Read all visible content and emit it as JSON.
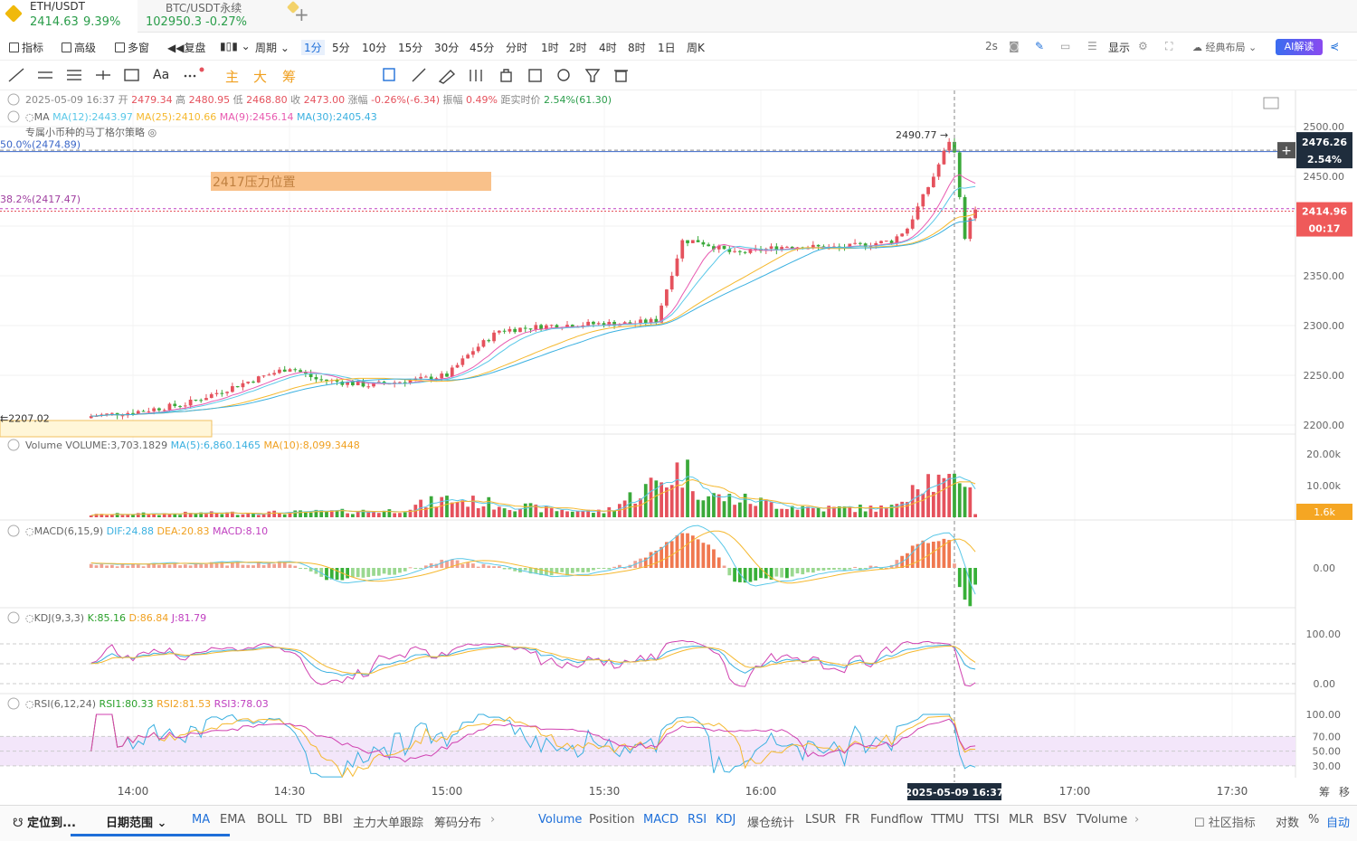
{
  "tabs": [
    {
      "symbol": "ETH/USDT",
      "price": "2414.63",
      "change": "9.39%"
    },
    {
      "symbol": "BTC/USDT永续",
      "price": "102950.3",
      "change": "-0.27%"
    }
  ],
  "tab_add": "+",
  "toolbar": {
    "indicator": "指标",
    "advanced": "高级",
    "multi_window": "多窗",
    "replay": "复盘",
    "period": "周期",
    "timeframes": [
      "1分",
      "5分",
      "10分",
      "15分",
      "30分",
      "45分",
      "分时",
      "1时",
      "2时",
      "4时",
      "8时",
      "1日",
      "周K"
    ],
    "active_timeframe": "1分",
    "refresh": "2s",
    "display": "显示",
    "layout": "经典布局",
    "ai": "AI解读"
  },
  "draw_tools": {
    "text": "Aa",
    "main": "主",
    "big": "大",
    "chip": "筹"
  },
  "info": {
    "date": "2025-05-09 16:37",
    "open_label": "开",
    "open": "2479.34",
    "high_label": "高",
    "high": "2480.95",
    "low_label": "低",
    "low": "2468.80",
    "close_label": "收",
    "close": "2473.00",
    "chg_label": "涨幅",
    "chg": "-0.26%(-6.34)",
    "amp_label": "振幅",
    "amp": "0.49%",
    "dist_label": "距实时价",
    "dist": "2.54%(61.30)"
  },
  "ma_legend": {
    "label": "MA",
    "ma12": "MA(12):2443.97",
    "ma25": "MA(25):2410.66",
    "ma9": "MA(9):2456.14",
    "ma30": "MA(30):2405.43"
  },
  "strategy": "专属小币种的马丁格尔策略",
  "annotations": {
    "fib50": "50.0%(2474.89)",
    "fib38": "38.2%(2417.47)",
    "pressure": "2417压力位置",
    "high_marker": "2490.77",
    "low_marker": "2207.02"
  },
  "price_axis": {
    "ticks": [
      "2500.00",
      "2450.00",
      "2350.00",
      "2300.00",
      "2250.00",
      "2200.00"
    ],
    "crosshair_price": "2476.26",
    "crosshair_pct": "2.54%",
    "last_price": "2414.96",
    "countdown": "00:17"
  },
  "volume_legend": {
    "label": "Volume",
    "vol": "VOLUME:3,703.1829",
    "ma5": "MA(5):6,860.1465",
    "ma10": "MA(10):8,099.3448"
  },
  "volume_axis": {
    "ticks": [
      "20.00k",
      "10.00k"
    ],
    "last": "1.6k"
  },
  "macd_legend": {
    "label": "MACD(6,15,9)",
    "dif": "DIF:24.88",
    "dea": "DEA:20.83",
    "macd": "MACD:8.10"
  },
  "macd_axis": {
    "ticks": [
      "0.00"
    ]
  },
  "kdj_legend": {
    "label": "KDJ(9,3,3)",
    "k": "K:85.16",
    "d": "D:86.84",
    "j": "J:81.79"
  },
  "kdj_axis": {
    "ticks": [
      "100.00",
      "0.00"
    ]
  },
  "rsi_legend": {
    "label": "RSI(6,12,24)",
    "rsi1": "RSI1:80.33",
    "rsi2": "RSI2:81.53",
    "rsi3": "RSI3:78.03"
  },
  "rsi_axis": {
    "ticks": [
      "100.00",
      "70.00",
      "50.00",
      "30.00"
    ]
  },
  "time_axis": {
    "ticks": [
      "14:00",
      "14:30",
      "15:00",
      "15:30",
      "16:00",
      "17:00",
      "17:30"
    ],
    "crosshair": "2025-05-09 16:37",
    "right": "筹",
    "right2": "移"
  },
  "bottom": {
    "locate": "定位到...",
    "range": "日期范围",
    "main_inds": [
      "MA",
      "EMA",
      "BOLL",
      "TD",
      "BBI",
      "主力大单跟踪",
      "筹码分布"
    ],
    "sub_inds": [
      "Volume",
      "Position",
      "MACD",
      "RSI",
      "KDJ",
      "爆仓统计",
      "LSUR",
      "FR",
      "Fundflow",
      "TTMU",
      "TTSI",
      "MLR",
      "BSV",
      "TVolume"
    ],
    "community": "社区指标",
    "log": "对数",
    "pct": "%",
    "auto": "自动"
  },
  "chart_data": {
    "type": "candlestick",
    "symbol": "ETH/USDT",
    "interval": "1m",
    "x_range": [
      "13:52",
      "16:41"
    ],
    "price_range": [
      2190,
      2510
    ],
    "colors": {
      "up": "#e5525d",
      "down": "#3aa93a",
      "ma12": "#5ac8e8",
      "ma25": "#f5b82e",
      "ma9": "#e85ab0",
      "ma30": "#3ab0e0"
    },
    "price_path": [
      [
        "13:52",
        2209
      ],
      [
        "14:00",
        2213
      ],
      [
        "14:10",
        2221
      ],
      [
        "14:20",
        2240
      ],
      [
        "14:30",
        2258
      ],
      [
        "14:35",
        2246
      ],
      [
        "14:45",
        2240
      ],
      [
        "14:55",
        2246
      ],
      [
        "15:00",
        2250
      ],
      [
        "15:05",
        2275
      ],
      [
        "15:10",
        2295
      ],
      [
        "15:20",
        2300
      ],
      [
        "15:30",
        2302
      ],
      [
        "15:35",
        2302
      ],
      [
        "15:40",
        2305
      ],
      [
        "15:45",
        2385
      ],
      [
        "15:48",
        2385
      ],
      [
        "15:55",
        2372
      ],
      [
        "16:05",
        2380
      ],
      [
        "16:15",
        2378
      ],
      [
        "16:25",
        2385
      ],
      [
        "16:28",
        2398
      ],
      [
        "16:33",
        2450
      ],
      [
        "16:36",
        2486
      ],
      [
        "16:37",
        2473
      ],
      [
        "16:38",
        2432
      ],
      [
        "16:39",
        2385
      ],
      [
        "16:40",
        2410
      ],
      [
        "16:41",
        2415
      ]
    ],
    "volume_path": [
      [
        "13:52",
        800
      ],
      [
        "14:00",
        1100
      ],
      [
        "14:30",
        1600
      ],
      [
        "14:50",
        2200
      ],
      [
        "15:00",
        6000
      ],
      [
        "15:20",
        2500
      ],
      [
        "15:30",
        1800
      ],
      [
        "15:45",
        16000
      ],
      [
        "15:50",
        7000
      ],
      [
        "16:10",
        3000
      ],
      [
        "16:25",
        3000
      ],
      [
        "16:30",
        14000
      ],
      [
        "16:36",
        10000
      ],
      [
        "16:39",
        15000
      ],
      [
        "16:41",
        1600
      ]
    ],
    "macd_path": [
      [
        "13:52",
        0.5
      ],
      [
        "14:30",
        1
      ],
      [
        "14:38",
        -2.5
      ],
      [
        "14:50",
        -1
      ],
      [
        "15:00",
        1.5
      ],
      [
        "15:20",
        -1.5
      ],
      [
        "15:35",
        0.5
      ],
      [
        "15:45",
        7
      ],
      [
        "15:50",
        5
      ],
      [
        "15:55",
        -3
      ],
      [
        "16:10",
        -1
      ],
      [
        "16:25",
        0.5
      ],
      [
        "16:30",
        5
      ],
      [
        "16:36",
        6
      ],
      [
        "16:38",
        -4
      ],
      [
        "16:40",
        -8
      ],
      [
        "16:41",
        -3
      ]
    ],
    "kdj": {
      "k": 85.16,
      "d": 86.84,
      "j": 81.79
    },
    "rsi": {
      "rsi1": 80.33,
      "rsi2": 81.53,
      "rsi3": 78.03,
      "levels": [
        70,
        50,
        30
      ]
    },
    "fib_levels": [
      {
        "label": "50.0%",
        "price": 2474.89
      },
      {
        "label": "38.2%",
        "price": 2417.47
      }
    ],
    "crosshair": {
      "time": "16:37",
      "price": 2476.26
    }
  }
}
